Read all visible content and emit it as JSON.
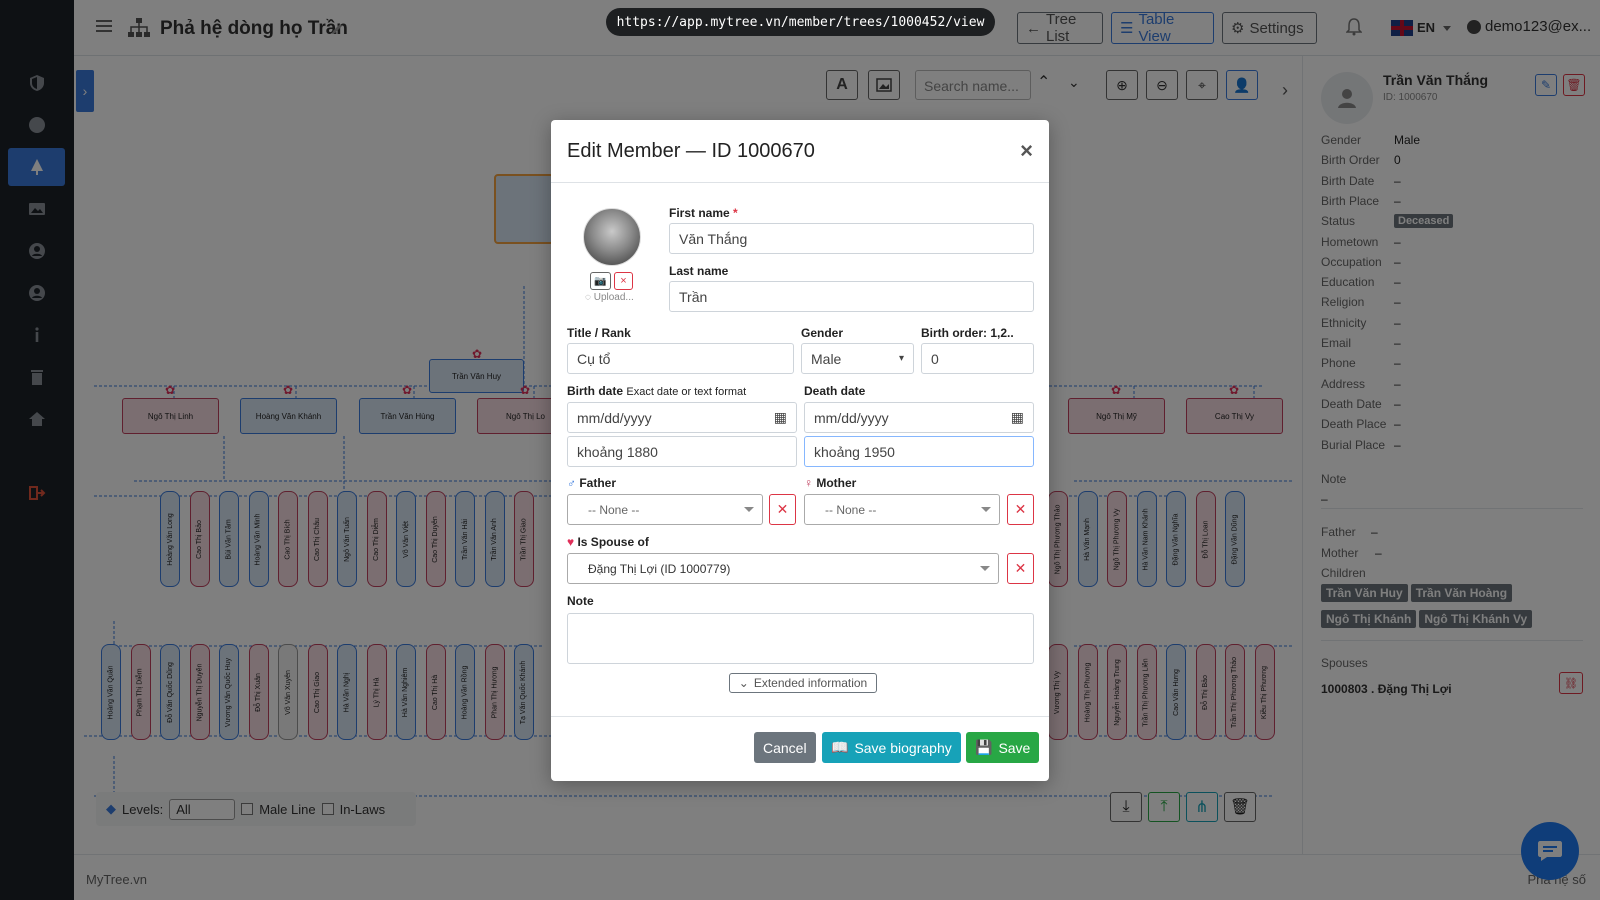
{
  "url": "https://app.mytree.vn/member/trees/1000452/view",
  "header": {
    "tree_title": "Phả hệ dòng họ Trần",
    "tree_list_label": "Tree List",
    "table_view_label": "Table View",
    "settings_label": "Settings",
    "lang": "EN",
    "user": "demo123@ex..."
  },
  "toolbar": {
    "search_placeholder": "Search name..."
  },
  "bottom_controls": {
    "levels_label": "Levels:",
    "levels_value": "All",
    "male_line": "Male Line",
    "in_laws": "In-Laws"
  },
  "footer": {
    "left": "MyTree.vn",
    "right": "Phả hệ số"
  },
  "tree": {
    "gen1": [
      "Trần Văn Huy"
    ],
    "gen2": [
      "Ngô Thị Linh",
      "Hoàng Văn Khánh",
      "Trần Văn Hùng",
      "Ngô Thị Lo",
      "Ngô Thị Mỹ",
      "Cao Thị Vy"
    ],
    "gen3_left": [
      "Hoàng Văn Long",
      "Cao Thị Bảo",
      "Bùi Văn Tâm",
      "Hoàng Văn Minh",
      "Cao Thị Bích",
      "Cao Thị Châu",
      "Ngô Văn Tuấn",
      "Cao Thị Diễm",
      "Võ Văn Việt",
      "Cao Thị Duyên",
      "Trần Văn Hải",
      "Trần Văn Anh",
      "Trần Thị Giao"
    ],
    "gen3_right": [
      "Ngô Thị Phương Thảo",
      "Hà Văn Mạnh",
      "Ngô Thị Phương Vy",
      "Hà Văn Nam Khánh",
      "Đặng Văn Nghĩa",
      "Đỗ Thị Loan",
      "Đặng Văn Dũng"
    ],
    "gen4_left": [
      "Hoàng Văn Quân",
      "Phạm Thị Diễm",
      "Đỗ Văn Quốc Dũng",
      "Nguyễn Thị Duyên",
      "Vương Văn Quốc Huy",
      "Đỗ Thị Xuân",
      "Võ Văn Xuyên",
      "Cao Thị Giao",
      "Hà Văn Nghị",
      "Lý Thị Hà",
      "Hà Văn Nghiêm",
      "Cao Thị Hà",
      "Hoàng Văn Rồng",
      "Phan Thị Hương",
      "Tạ Văn Quốc Khánh"
    ],
    "gen4_right": [
      "Vương Thị Vy",
      "Hoàng Thị Phương",
      "Nguyễn Hoàng Trung",
      "Trần Thị Phương Liên",
      "Cao Văn Hưng",
      "Đỗ Thị Bảo",
      "Trần Thị Phương Thảo",
      "Kiều Thị Phương"
    ]
  },
  "modal": {
    "title": "Edit Member — ID 1000670",
    "upload_label": "Upload...",
    "first_name_label": "First name",
    "required_mark": "*",
    "first_name": "Văn Thắng",
    "last_name_label": "Last name",
    "last_name": "Trần",
    "title_label": "Title / Rank",
    "title_value": "Cụ tổ",
    "gender_label": "Gender",
    "gender_value": "Male",
    "birth_order_label": "Birth order: 1,2..",
    "birth_order_value": "0",
    "birth_date_label": "Birth date",
    "birth_date_hint": "Exact date or text format",
    "death_date_label": "Death date",
    "date_placeholder": "mm/dd/yyyy",
    "birth_text": "khoảng 1880",
    "death_text": "khoảng 1950",
    "father_label": "Father",
    "mother_label": "Mother",
    "none_option": "-- None --",
    "spouse_label": "Is Spouse of",
    "spouse_value": "Đặng Thị Lợi (ID 1000779)",
    "note_label": "Note",
    "extended_label": "Extended information",
    "cancel": "Cancel",
    "save_bio": "Save biography",
    "save": "Save"
  },
  "detail": {
    "name": "Trần Văn Thắng",
    "id": "ID: 1000670",
    "fields": [
      {
        "k": "Gender",
        "v": "Male"
      },
      {
        "k": "Birth Order",
        "v": "0"
      },
      {
        "k": "Birth Date",
        "v": "–"
      },
      {
        "k": "Birth Place",
        "v": "–"
      },
      {
        "k": "Status",
        "v": "Deceased"
      },
      {
        "k": "Hometown",
        "v": "–"
      },
      {
        "k": "Occupation",
        "v": "–"
      },
      {
        "k": "Education",
        "v": "–"
      },
      {
        "k": "Religion",
        "v": "–"
      },
      {
        "k": "Ethnicity",
        "v": "–"
      },
      {
        "k": "Email",
        "v": "–"
      },
      {
        "k": "Phone",
        "v": "–"
      },
      {
        "k": "Address",
        "v": "–"
      },
      {
        "k": "Death Date",
        "v": "–"
      },
      {
        "k": "Death Place",
        "v": "–"
      },
      {
        "k": "Burial Place",
        "v": "–"
      }
    ],
    "note_label": "Note",
    "note_value": "–",
    "father_label": "Father",
    "father_value": "–",
    "mother_label": "Mother",
    "mother_value": "–",
    "children_label": "Children",
    "children": [
      "Trần Văn Huy",
      "Trần Văn Hoàng",
      "Ngô Thị Khánh",
      "Ngô Thị Khánh Vy"
    ],
    "spouses_label": "Spouses",
    "spouse": "1000803 . Đặng Thị Lợi"
  },
  "colors": {
    "sidebar": "#1c2229",
    "accent": "#3b7bdc",
    "male_node": "#d9e6f5",
    "female_node": "#f7dde3",
    "save_green": "#28a745",
    "bio_teal": "#17a2b8",
    "danger": "#dc3545"
  }
}
